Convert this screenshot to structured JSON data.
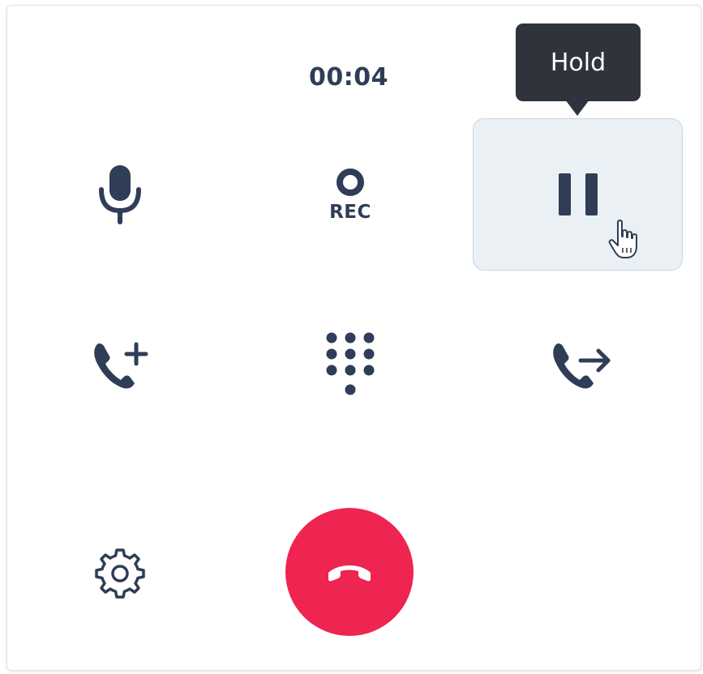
{
  "call": {
    "timer": "00:04"
  },
  "controls": {
    "mute": {
      "icon": "microphone-icon"
    },
    "record": {
      "icon": "record-icon",
      "label": "REC"
    },
    "hold": {
      "icon": "pause-icon",
      "tooltip": "Hold"
    },
    "add_call": {
      "icon": "phone-plus-icon"
    },
    "keypad": {
      "icon": "dialpad-icon"
    },
    "transfer": {
      "icon": "phone-forward-icon"
    },
    "settings": {
      "icon": "gear-icon"
    },
    "hangup": {
      "icon": "phone-hangup-icon"
    }
  },
  "colors": {
    "icon": "#2f3d57",
    "hangup": "#ee2451",
    "tooltip_bg": "#2f333b",
    "hover_bg": "#ebf0f5"
  }
}
